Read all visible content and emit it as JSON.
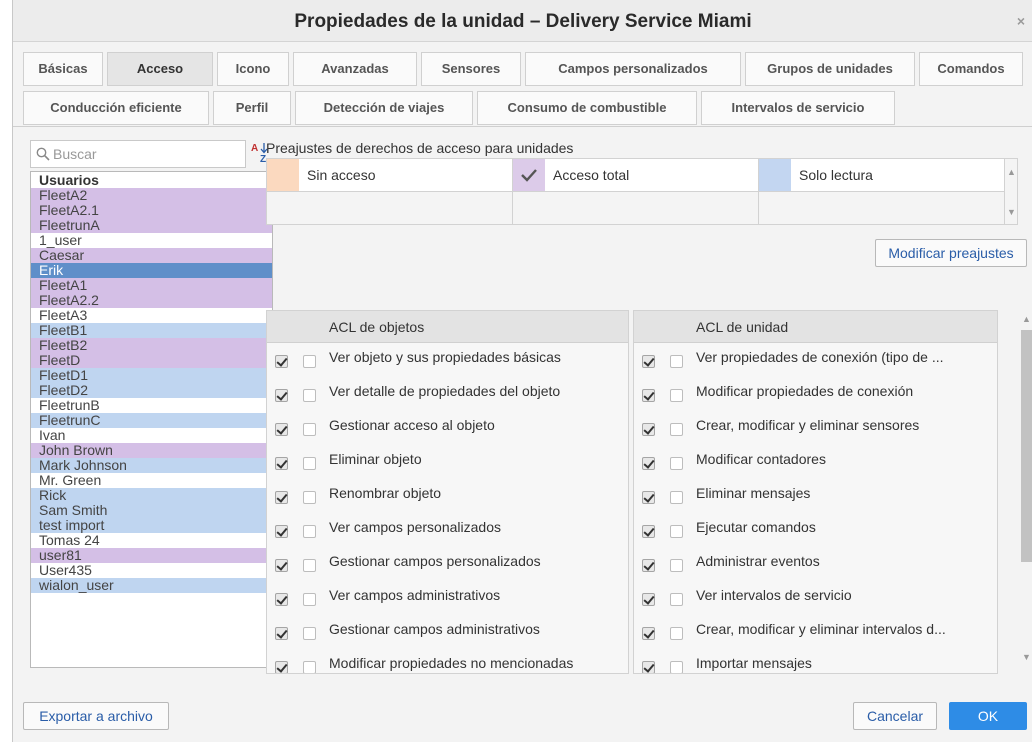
{
  "window": {
    "title": "Propiedades de la unidad – Delivery Service Miami",
    "close_glyph": "×"
  },
  "tabs_row1": [
    {
      "label": "Básicas",
      "active": false
    },
    {
      "label": "Acceso",
      "active": true
    },
    {
      "label": "Icono",
      "active": false
    },
    {
      "label": "Avanzadas",
      "active": false
    },
    {
      "label": "Sensores",
      "active": false
    },
    {
      "label": "Campos personalizados",
      "active": false
    },
    {
      "label": "Grupos de unidades",
      "active": false
    },
    {
      "label": "Comandos",
      "active": false
    }
  ],
  "tabs_row2": [
    {
      "label": "Conducción eficiente",
      "active": false
    },
    {
      "label": "Perfil",
      "active": false
    },
    {
      "label": "Detección de viajes",
      "active": false
    },
    {
      "label": "Consumo de combustible",
      "active": false
    },
    {
      "label": "Intervalos de servicio",
      "active": false
    }
  ],
  "search": {
    "placeholder": "Buscar",
    "icon": "magnifier-icon",
    "sort_icon": "sort-az-icon"
  },
  "users": {
    "header": "Usuarios",
    "items": [
      {
        "name": "FleetA2",
        "color": "purple"
      },
      {
        "name": "FleetA2.1",
        "color": "purple"
      },
      {
        "name": "FleetrunA",
        "color": "purple"
      },
      {
        "name": "1_user",
        "color": "white"
      },
      {
        "name": "Caesar",
        "color": "purple"
      },
      {
        "name": "Erik",
        "color": "selected"
      },
      {
        "name": "FleetA1",
        "color": "purple"
      },
      {
        "name": "FleetA2.2",
        "color": "purple"
      },
      {
        "name": "FleetA3",
        "color": "white"
      },
      {
        "name": "FleetB1",
        "color": "blue"
      },
      {
        "name": "FleetB2",
        "color": "purple"
      },
      {
        "name": "FleetD",
        "color": "purple"
      },
      {
        "name": "FleetD1",
        "color": "blue"
      },
      {
        "name": "FleetD2",
        "color": "blue"
      },
      {
        "name": "FleetrunB",
        "color": "white"
      },
      {
        "name": "FleetrunC",
        "color": "blue"
      },
      {
        "name": "Ivan",
        "color": "white"
      },
      {
        "name": "John Brown",
        "color": "purple"
      },
      {
        "name": "Mark Johnson",
        "color": "blue"
      },
      {
        "name": "Mr. Green",
        "color": "white"
      },
      {
        "name": "Rick",
        "color": "blue"
      },
      {
        "name": "Sam Smith",
        "color": "blue"
      },
      {
        "name": "test import",
        "color": "blue"
      },
      {
        "name": "Tomas 24",
        "color": "white"
      },
      {
        "name": "user81",
        "color": "purple"
      },
      {
        "name": "User435",
        "color": "white"
      },
      {
        "name": "wialon_user",
        "color": "blue"
      }
    ]
  },
  "presets": {
    "title": "Preajustes de derechos de acceso para unidades",
    "items": [
      {
        "label": "Sin acceso",
        "color": "#fbd9bf",
        "checked": false
      },
      {
        "label": "Acceso total",
        "color": "#dccbe9",
        "checked": true
      },
      {
        "label": "Solo lectura",
        "color": "#c3d6f1",
        "checked": false
      }
    ],
    "modify_label": "Modificar preajustes"
  },
  "acl_objects": {
    "header": "ACL de objetos",
    "rows": [
      {
        "label": "Ver objeto y sus propiedades básicas",
        "checked": true
      },
      {
        "label": "Ver detalle de propiedades del objeto",
        "checked": true
      },
      {
        "label": "Gestionar acceso al objeto",
        "checked": true
      },
      {
        "label": "Eliminar objeto",
        "checked": true
      },
      {
        "label": "Renombrar objeto",
        "checked": true
      },
      {
        "label": "Ver campos personalizados",
        "checked": true
      },
      {
        "label": "Gestionar campos personalizados",
        "checked": true
      },
      {
        "label": "Ver campos administrativos",
        "checked": true
      },
      {
        "label": "Gestionar campos administrativos",
        "checked": true
      },
      {
        "label": "Modificar propiedades no mencionadas",
        "checked": true
      }
    ]
  },
  "acl_unit": {
    "header": "ACL de unidad",
    "rows": [
      {
        "label": "Ver propiedades de conexión (tipo de ...",
        "checked": true
      },
      {
        "label": "Modificar propiedades de conexión",
        "checked": true
      },
      {
        "label": "Crear, modificar y eliminar sensores",
        "checked": true
      },
      {
        "label": "Modificar contadores",
        "checked": true
      },
      {
        "label": "Eliminar mensajes",
        "checked": true
      },
      {
        "label": "Ejecutar comandos",
        "checked": true
      },
      {
        "label": "Administrar eventos",
        "checked": true
      },
      {
        "label": "Ver intervalos de servicio",
        "checked": true
      },
      {
        "label": "Crear, modificar y eliminar intervalos d...",
        "checked": true
      },
      {
        "label": "Importar mensajes",
        "checked": true
      }
    ]
  },
  "footer": {
    "export_label": "Exportar a archivo",
    "cancel_label": "Cancelar",
    "ok_label": "OK"
  }
}
